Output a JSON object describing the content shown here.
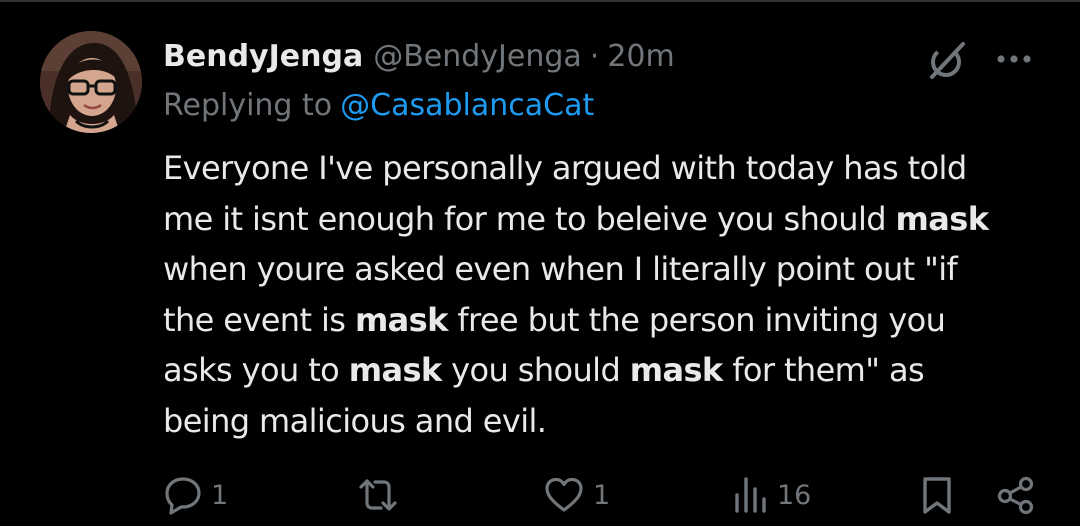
{
  "tweet": {
    "author": {
      "display_name": "BendyJenga",
      "handle": "@BendyJenga",
      "avatar_icon": "profile-photo"
    },
    "separator": "·",
    "time_ago": "20m",
    "replying_to_label": "Replying to",
    "replying_to_handle": "@CasablancaCat",
    "text_lines": [
      [
        {
          "t": "Everyone I've personally argued with  today has told",
          "b": false
        }
      ],
      [
        {
          "t": "me it isnt enough for me to beleive you should ",
          "b": false
        },
        {
          "t": "mask",
          "b": true
        }
      ],
      [
        {
          "t": "when youre asked even when I literally point out \"if",
          "b": false
        }
      ],
      [
        {
          "t": "the event is ",
          "b": false
        },
        {
          "t": "mask",
          "b": true
        },
        {
          "t": " free but the person inviting you",
          "b": false
        }
      ],
      [
        {
          "t": "asks you to ",
          "b": false
        },
        {
          "t": "mask",
          "b": true
        },
        {
          "t": " you should ",
          "b": false
        },
        {
          "t": "mask",
          "b": true
        },
        {
          "t": " for them\" as",
          "b": false
        }
      ],
      [
        {
          "t": "being malicious and evil.",
          "b": false
        }
      ]
    ]
  },
  "actions": {
    "reply": {
      "icon": "reply-icon",
      "count": "1"
    },
    "retweet": {
      "icon": "retweet-icon",
      "count": ""
    },
    "like": {
      "icon": "heart-icon",
      "count": "1"
    },
    "views": {
      "icon": "views-icon",
      "count": "16"
    },
    "bookmark": {
      "icon": "bookmark-icon"
    },
    "share": {
      "icon": "share-icon"
    }
  },
  "header_icons": {
    "grok": "grok-icon",
    "more": "more-icon"
  },
  "colors": {
    "background": "#000000",
    "text_primary": "#e7e9ea",
    "text_secondary": "#71767b",
    "link": "#1d9bf0",
    "divider": "#2f3336"
  }
}
